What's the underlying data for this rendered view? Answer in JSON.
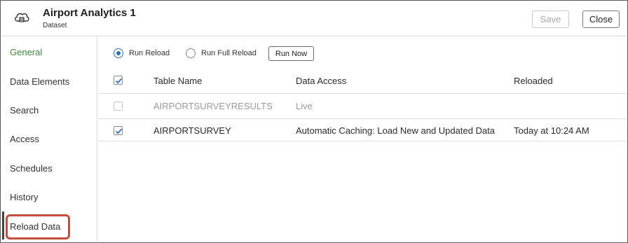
{
  "header": {
    "title": "Airport Analytics 1",
    "subtitle": "Dataset",
    "save_label": "Save",
    "close_label": "Close"
  },
  "sidebar": {
    "items": [
      {
        "label": "General",
        "active": true
      },
      {
        "label": "Data Elements",
        "active": false
      },
      {
        "label": "Search",
        "active": false
      },
      {
        "label": "Access",
        "active": false
      },
      {
        "label": "Schedules",
        "active": false
      },
      {
        "label": "History",
        "active": false
      },
      {
        "label": "Reload Data",
        "active": false,
        "highlighted": true
      }
    ]
  },
  "reload": {
    "options": [
      {
        "label": "Run Reload",
        "selected": true
      },
      {
        "label": "Run Full Reload",
        "selected": false
      }
    ],
    "run_now_label": "Run Now"
  },
  "table": {
    "header_checked": true,
    "columns": [
      "Table Name",
      "Data Access",
      "Reloaded"
    ],
    "rows": [
      {
        "checked": false,
        "disabled": true,
        "name": "AIRPORTSURVEYRESULTS",
        "access": "Live",
        "reloaded": ""
      },
      {
        "checked": true,
        "disabled": false,
        "name": "AIRPORTSURVEY",
        "access": "Automatic Caching: Load New and Updated Data",
        "reloaded": "Today at 10:24 AM"
      }
    ]
  },
  "colors": {
    "accent_blue": "#2f6fc0",
    "active_green": "#3d8a3d",
    "highlight_red": "#c34f3c"
  }
}
